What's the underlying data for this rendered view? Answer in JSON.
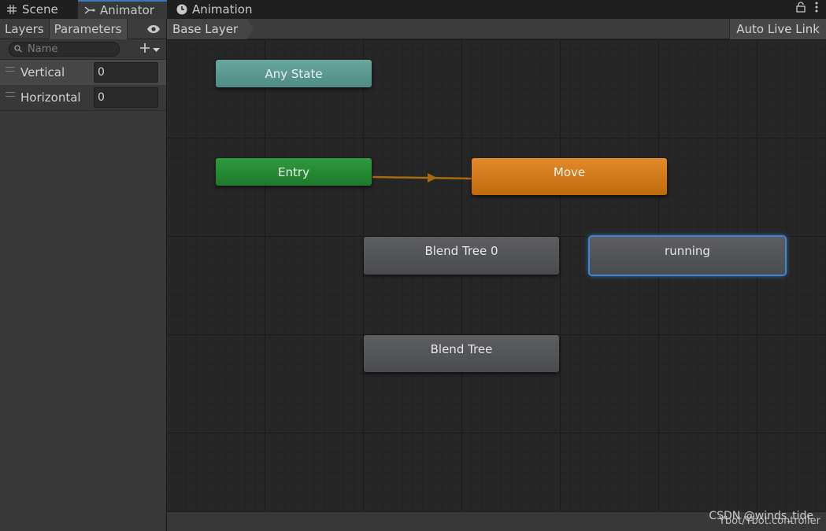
{
  "window_tabs": [
    {
      "label": "Scene",
      "icon": "grid-icon",
      "active": false
    },
    {
      "label": "Animator",
      "icon": "animator-icon",
      "active": true
    },
    {
      "label": "Animation",
      "icon": "clock-icon",
      "active": false
    }
  ],
  "left_panel": {
    "tabs": [
      "Layers",
      "Parameters"
    ],
    "search_placeholder": "Name",
    "parameters": [
      {
        "name": "Vertical",
        "value": "0"
      },
      {
        "name": "Horizontal",
        "value": "0"
      }
    ]
  },
  "graph_header": {
    "breadcrumb": "Base Layer",
    "auto_live_link": "Auto Live Link"
  },
  "graph": {
    "nodes": {
      "any_state": "Any State",
      "entry": "Entry",
      "move": "Move",
      "blend_tree_0": "Blend Tree 0",
      "running": "running",
      "blend_tree": "Blend Tree"
    },
    "transitions": [
      {
        "from": "Entry",
        "to": "Move"
      }
    ]
  },
  "status": {
    "controller_path": "Ybot/Ybot.controller",
    "watermark": "CSDN @winds_tide"
  },
  "colors": {
    "any_state": "#5a9a91",
    "entry": "#238a33",
    "move": "#d27a1c",
    "default_state": "#545558",
    "selection": "#3d86d6",
    "transition": "#a76a10"
  }
}
